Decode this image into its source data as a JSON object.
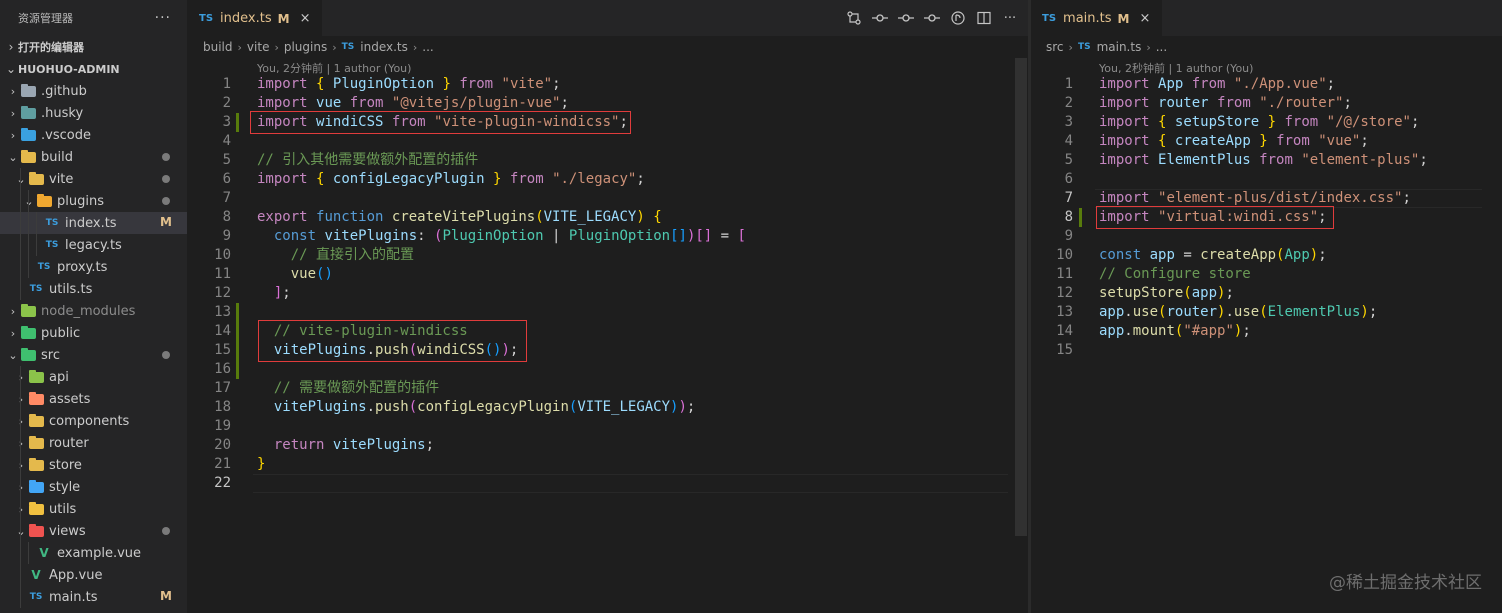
{
  "explorer": {
    "title": "资源管理器",
    "more": "···",
    "open_editors": "打开的编辑器",
    "project": "HUOHUO-ADMIN",
    "items": [
      {
        "label": ".github",
        "depth": 1,
        "kind": "folder",
        "color": "#9aa6b2",
        "expanded": false
      },
      {
        "label": ".husky",
        "depth": 1,
        "kind": "folder",
        "color": "#5f9ea0",
        "expanded": false
      },
      {
        "label": ".vscode",
        "depth": 1,
        "kind": "folder",
        "color": "#3aa1e0",
        "expanded": false
      },
      {
        "label": "build",
        "depth": 1,
        "kind": "folder",
        "color": "#e4b94c",
        "expanded": true,
        "dot": true
      },
      {
        "label": "vite",
        "depth": 2,
        "kind": "folder",
        "color": "#e4b94c",
        "expanded": true,
        "dot": true
      },
      {
        "label": "plugins",
        "depth": 3,
        "kind": "folder",
        "color": "#f0a830",
        "expanded": true,
        "dot": true
      },
      {
        "label": "index.ts",
        "depth": 4,
        "kind": "ts",
        "selected": true,
        "mod": "M"
      },
      {
        "label": "legacy.ts",
        "depth": 4,
        "kind": "ts"
      },
      {
        "label": "proxy.ts",
        "depth": 3,
        "kind": "ts"
      },
      {
        "label": "utils.ts",
        "depth": 2,
        "kind": "ts"
      },
      {
        "label": "node_modules",
        "depth": 1,
        "kind": "folder",
        "color": "#8bc34a",
        "expanded": false,
        "dim": true
      },
      {
        "label": "public",
        "depth": 1,
        "kind": "folder",
        "color": "#3fbf6f",
        "expanded": false
      },
      {
        "label": "src",
        "depth": 1,
        "kind": "folder",
        "color": "#3fbf6f",
        "expanded": true,
        "dot": true
      },
      {
        "label": "api",
        "depth": 2,
        "kind": "folder",
        "color": "#8bc34a",
        "expanded": false
      },
      {
        "label": "assets",
        "depth": 2,
        "kind": "folder",
        "color": "#ff8a65",
        "expanded": false
      },
      {
        "label": "components",
        "depth": 2,
        "kind": "folder",
        "color": "#e4b94c",
        "expanded": false
      },
      {
        "label": "router",
        "depth": 2,
        "kind": "folder",
        "color": "#e4b94c",
        "expanded": false
      },
      {
        "label": "store",
        "depth": 2,
        "kind": "folder",
        "color": "#e4b94c",
        "expanded": false
      },
      {
        "label": "style",
        "depth": 2,
        "kind": "folder",
        "color": "#42a5f5",
        "expanded": false
      },
      {
        "label": "utils",
        "depth": 2,
        "kind": "folder",
        "color": "#f0c040",
        "expanded": false
      },
      {
        "label": "views",
        "depth": 2,
        "kind": "folder",
        "color": "#ef5350",
        "expanded": true,
        "dot": true
      },
      {
        "label": "example.vue",
        "depth": 3,
        "kind": "vue"
      },
      {
        "label": "App.vue",
        "depth": 2,
        "kind": "vue"
      },
      {
        "label": "main.ts",
        "depth": 2,
        "kind": "ts",
        "mod": "M"
      }
    ]
  },
  "left_editor": {
    "tab": {
      "icon": "TS",
      "name": "index.ts",
      "modified": "M",
      "close": "×"
    },
    "breadcrumbs": [
      "build",
      "vite",
      "plugins",
      "index.ts",
      "..."
    ],
    "blame": "You, 2分钟前 | 1 author (You)",
    "lines": [
      [
        [
          "kw",
          "import"
        ],
        [
          "pl",
          " "
        ],
        [
          "b1",
          "{"
        ],
        [
          "pl",
          " "
        ],
        [
          "var",
          "PluginOption"
        ],
        [
          "pl",
          " "
        ],
        [
          "b1",
          "}"
        ],
        [
          "pl",
          " "
        ],
        [
          "kw",
          "from"
        ],
        [
          "pl",
          " "
        ],
        [
          "str",
          "\"vite\""
        ],
        [
          "pl",
          ";"
        ]
      ],
      [
        [
          "kw",
          "import"
        ],
        [
          "pl",
          " "
        ],
        [
          "var",
          "vue"
        ],
        [
          "pl",
          " "
        ],
        [
          "kw",
          "from"
        ],
        [
          "pl",
          " "
        ],
        [
          "str",
          "\"@vitejs/plugin-vue\""
        ],
        [
          "pl",
          ";"
        ]
      ],
      [
        [
          "kw",
          "import"
        ],
        [
          "pl",
          " "
        ],
        [
          "var",
          "windiCSS"
        ],
        [
          "pl",
          " "
        ],
        [
          "kw",
          "from"
        ],
        [
          "pl",
          " "
        ],
        [
          "str",
          "\"vite-plugin-windicss\""
        ],
        [
          "pl",
          ";"
        ]
      ],
      [],
      [
        [
          "cm",
          "// 引入其他需要做额外配置的插件"
        ]
      ],
      [
        [
          "kw",
          "import"
        ],
        [
          "pl",
          " "
        ],
        [
          "b1",
          "{"
        ],
        [
          "pl",
          " "
        ],
        [
          "var",
          "configLegacyPlugin"
        ],
        [
          "pl",
          " "
        ],
        [
          "b1",
          "}"
        ],
        [
          "pl",
          " "
        ],
        [
          "kw",
          "from"
        ],
        [
          "pl",
          " "
        ],
        [
          "str",
          "\"./legacy\""
        ],
        [
          "pl",
          ";"
        ]
      ],
      [],
      [
        [
          "kw",
          "export"
        ],
        [
          "pl",
          " "
        ],
        [
          "kb",
          "function"
        ],
        [
          "pl",
          " "
        ],
        [
          "fn",
          "createVitePlugins"
        ],
        [
          "b1",
          "("
        ],
        [
          "var",
          "VITE_LEGACY"
        ],
        [
          "b1",
          ")"
        ],
        [
          "pl",
          " "
        ],
        [
          "b1",
          "{"
        ]
      ],
      [
        [
          "pl",
          "  "
        ],
        [
          "kb",
          "const"
        ],
        [
          "pl",
          " "
        ],
        [
          "var",
          "vitePlugins"
        ],
        [
          "pl",
          ": "
        ],
        [
          "b2",
          "("
        ],
        [
          "ty",
          "PluginOption"
        ],
        [
          "pl",
          " | "
        ],
        [
          "ty",
          "PluginOption"
        ],
        [
          "b3",
          "[]"
        ],
        [
          "b2",
          ")"
        ],
        [
          "b2",
          "[]"
        ],
        [
          "pl",
          " = "
        ],
        [
          "b2",
          "["
        ]
      ],
      [
        [
          "pl",
          "    "
        ],
        [
          "cm",
          "// 直接引入的配置"
        ]
      ],
      [
        [
          "pl",
          "    "
        ],
        [
          "fn",
          "vue"
        ],
        [
          "b3",
          "()"
        ]
      ],
      [
        [
          "pl",
          "  "
        ],
        [
          "b2",
          "]"
        ],
        [
          "pl",
          ";"
        ]
      ],
      [],
      [
        [
          "pl",
          "  "
        ],
        [
          "cm",
          "// vite-plugin-windicss"
        ]
      ],
      [
        [
          "pl",
          "  "
        ],
        [
          "var",
          "vitePlugins"
        ],
        [
          "pl",
          "."
        ],
        [
          "fn",
          "push"
        ],
        [
          "b2",
          "("
        ],
        [
          "fn",
          "windiCSS"
        ],
        [
          "b3",
          "()"
        ],
        [
          "b2",
          ")"
        ],
        [
          "pl",
          ";"
        ]
      ],
      [],
      [
        [
          "pl",
          "  "
        ],
        [
          "cm",
          "// 需要做额外配置的插件"
        ]
      ],
      [
        [
          "pl",
          "  "
        ],
        [
          "var",
          "vitePlugins"
        ],
        [
          "pl",
          "."
        ],
        [
          "fn",
          "push"
        ],
        [
          "b2",
          "("
        ],
        [
          "fn",
          "configLegacyPlugin"
        ],
        [
          "b3",
          "("
        ],
        [
          "var",
          "VITE_LEGACY"
        ],
        [
          "b3",
          ")"
        ],
        [
          "b2",
          ")"
        ],
        [
          "pl",
          ";"
        ]
      ],
      [],
      [
        [
          "pl",
          "  "
        ],
        [
          "kw",
          "return"
        ],
        [
          "pl",
          " "
        ],
        [
          "var",
          "vitePlugins"
        ],
        [
          "pl",
          ";"
        ]
      ],
      [
        [
          "b1",
          "}"
        ]
      ],
      []
    ]
  },
  "right_editor": {
    "tab": {
      "icon": "TS",
      "name": "main.ts",
      "modified": "M",
      "close": "×"
    },
    "breadcrumbs": [
      "src",
      "main.ts",
      "..."
    ],
    "blame": "You, 2秒钟前 | 1 author (You)",
    "lines": [
      [
        [
          "kw",
          "import"
        ],
        [
          "pl",
          " "
        ],
        [
          "var",
          "App"
        ],
        [
          "pl",
          " "
        ],
        [
          "kw",
          "from"
        ],
        [
          "pl",
          " "
        ],
        [
          "str",
          "\"./App.vue\""
        ],
        [
          "pl",
          ";"
        ]
      ],
      [
        [
          "kw",
          "import"
        ],
        [
          "pl",
          " "
        ],
        [
          "var",
          "router"
        ],
        [
          "pl",
          " "
        ],
        [
          "kw",
          "from"
        ],
        [
          "pl",
          " "
        ],
        [
          "str",
          "\"./router\""
        ],
        [
          "pl",
          ";"
        ]
      ],
      [
        [
          "kw",
          "import"
        ],
        [
          "pl",
          " "
        ],
        [
          "b1",
          "{"
        ],
        [
          "pl",
          " "
        ],
        [
          "var",
          "setupStore"
        ],
        [
          "pl",
          " "
        ],
        [
          "b1",
          "}"
        ],
        [
          "pl",
          " "
        ],
        [
          "kw",
          "from"
        ],
        [
          "pl",
          " "
        ],
        [
          "str",
          "\"/@/store\""
        ],
        [
          "pl",
          ";"
        ]
      ],
      [
        [
          "kw",
          "import"
        ],
        [
          "pl",
          " "
        ],
        [
          "b1",
          "{"
        ],
        [
          "pl",
          " "
        ],
        [
          "var",
          "createApp"
        ],
        [
          "pl",
          " "
        ],
        [
          "b1",
          "}"
        ],
        [
          "pl",
          " "
        ],
        [
          "kw",
          "from"
        ],
        [
          "pl",
          " "
        ],
        [
          "str",
          "\"vue\""
        ],
        [
          "pl",
          ";"
        ]
      ],
      [
        [
          "kw",
          "import"
        ],
        [
          "pl",
          " "
        ],
        [
          "var",
          "ElementPlus"
        ],
        [
          "pl",
          " "
        ],
        [
          "kw",
          "from"
        ],
        [
          "pl",
          " "
        ],
        [
          "str",
          "\"element-plus\""
        ],
        [
          "pl",
          ";"
        ]
      ],
      [],
      [
        [
          "kw",
          "import"
        ],
        [
          "pl",
          " "
        ],
        [
          "str",
          "\"element-plus/dist/index.css\""
        ],
        [
          "pl",
          ";"
        ]
      ],
      [
        [
          "kw",
          "import"
        ],
        [
          "pl",
          " "
        ],
        [
          "str",
          "\"virtual:windi.css\""
        ],
        [
          "pl",
          ";"
        ]
      ],
      [],
      [
        [
          "kb",
          "const"
        ],
        [
          "pl",
          " "
        ],
        [
          "var",
          "app"
        ],
        [
          "pl",
          " = "
        ],
        [
          "fn",
          "createApp"
        ],
        [
          "b1",
          "("
        ],
        [
          "ty",
          "App"
        ],
        [
          "b1",
          ")"
        ],
        [
          "pl",
          ";"
        ]
      ],
      [
        [
          "cm",
          "// Configure store"
        ]
      ],
      [
        [
          "fn",
          "setupStore"
        ],
        [
          "b1",
          "("
        ],
        [
          "var",
          "app"
        ],
        [
          "b1",
          ")"
        ],
        [
          "pl",
          ";"
        ]
      ],
      [
        [
          "var",
          "app"
        ],
        [
          "pl",
          "."
        ],
        [
          "fn",
          "use"
        ],
        [
          "b1",
          "("
        ],
        [
          "var",
          "router"
        ],
        [
          "b1",
          ")"
        ],
        [
          "pl",
          "."
        ],
        [
          "fn",
          "use"
        ],
        [
          "b1",
          "("
        ],
        [
          "ty",
          "ElementPlus"
        ],
        [
          "b1",
          ")"
        ],
        [
          "pl",
          ";"
        ]
      ],
      [
        [
          "var",
          "app"
        ],
        [
          "pl",
          "."
        ],
        [
          "fn",
          "mount"
        ],
        [
          "b1",
          "("
        ],
        [
          "str",
          "\"#app\""
        ],
        [
          "b1",
          ")"
        ],
        [
          "pl",
          ";"
        ]
      ],
      []
    ]
  },
  "watermark": "@稀土掘金技术社区",
  "colors": {
    "highlight_box": "#e03c3c",
    "modified": "#e2c08d",
    "added_gutter": "#587c0c"
  }
}
